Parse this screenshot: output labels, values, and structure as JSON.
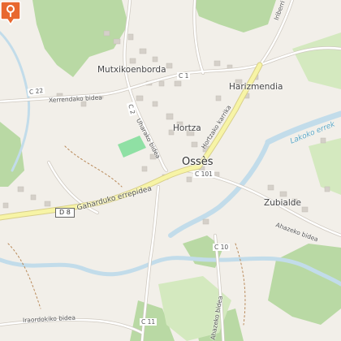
{
  "places": {
    "mutxikoenborda": "Mutxikoenborda",
    "harizmendia": "Harizmendia",
    "hortza": "Hortza",
    "osses": "Ossès",
    "zubialde": "Zubialde"
  },
  "roads": {
    "xerrendako": "Xerrendako bidea",
    "uharako": "Uharako bidea",
    "hortzako": "Hortzako karrika",
    "gaharduko": "Gaharduko errepidea",
    "ahazeko": "Ahazeko bidea",
    "iraordokiko": "Iraordokiko bidea",
    "iriberri": "Iriberri",
    "bottom_right": "Ahazeko bidea"
  },
  "refs": {
    "c22": "C 22",
    "c2": "C 2",
    "c1": "C 1",
    "c101": "C 101",
    "c10": "C 10",
    "c11": "C 11",
    "d8": "D 8"
  },
  "water": {
    "lakoko": "Lakoko errek"
  },
  "marker": {
    "icon": "map-pin-icon",
    "color": "#e8682f"
  },
  "colors": {
    "land": "#f2efe9",
    "forest": "#b9d9a4",
    "grass": "#d4e9bf",
    "river": "#c2dcea",
    "road_major": "#f7f4a6",
    "building": "#d5d0c9",
    "park": "#8fe0a4"
  }
}
